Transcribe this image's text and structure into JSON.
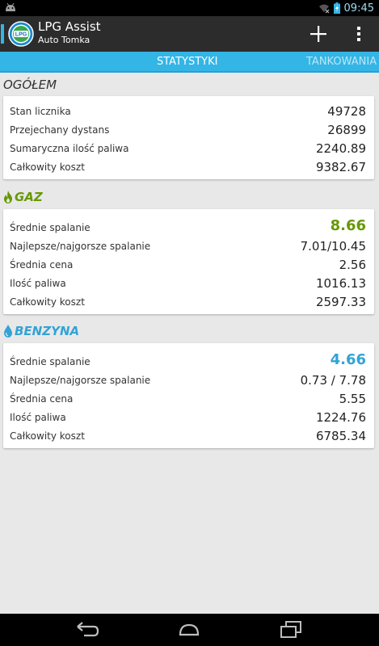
{
  "status_bar": {
    "time": "09:45"
  },
  "action_bar": {
    "title": "LPG Assist",
    "subtitle": "Auto Tomka",
    "logo_text": "LPG"
  },
  "tabs": [
    {
      "label": "STATYSTYKI",
      "selected": true
    },
    {
      "label": "TANKOWANIA",
      "selected": false
    }
  ],
  "sections": {
    "ogolem": {
      "title": "OGÓŁEM",
      "rows": [
        {
          "label": "Stan licznika",
          "value": "49728"
        },
        {
          "label": "Przejechany dystans",
          "value": "26899"
        },
        {
          "label": "Sumaryczna ilość paliwa",
          "value": "2240.89"
        },
        {
          "label": "Całkowity koszt",
          "value": "9382.67"
        }
      ]
    },
    "gaz": {
      "title": "GAZ",
      "icon": "flame-icon",
      "color": "#669900",
      "rows": [
        {
          "label": "Średnie spalanie",
          "value": "8.66"
        },
        {
          "label": "Najlepsze/najgorsze spalanie",
          "value": "7.01/10.45"
        },
        {
          "label": "Średnia cena",
          "value": "2.56"
        },
        {
          "label": "Ilość paliwa",
          "value": "1016.13"
        },
        {
          "label": "Całkowity koszt",
          "value": "2597.33"
        }
      ]
    },
    "benzyna": {
      "title": "BENZYNA",
      "icon": "drop-icon",
      "color": "#33a3d6",
      "rows": [
        {
          "label": "Średnie spalanie",
          "value": "4.66"
        },
        {
          "label": "Najlepsze/najgorsze spalanie",
          "value": "0.73 / 7.78"
        },
        {
          "label": "Średnia cena",
          "value": "5.55"
        },
        {
          "label": "Ilość paliwa",
          "value": "1224.76"
        },
        {
          "label": "Całkowity koszt",
          "value": "6785.34"
        }
      ]
    }
  }
}
